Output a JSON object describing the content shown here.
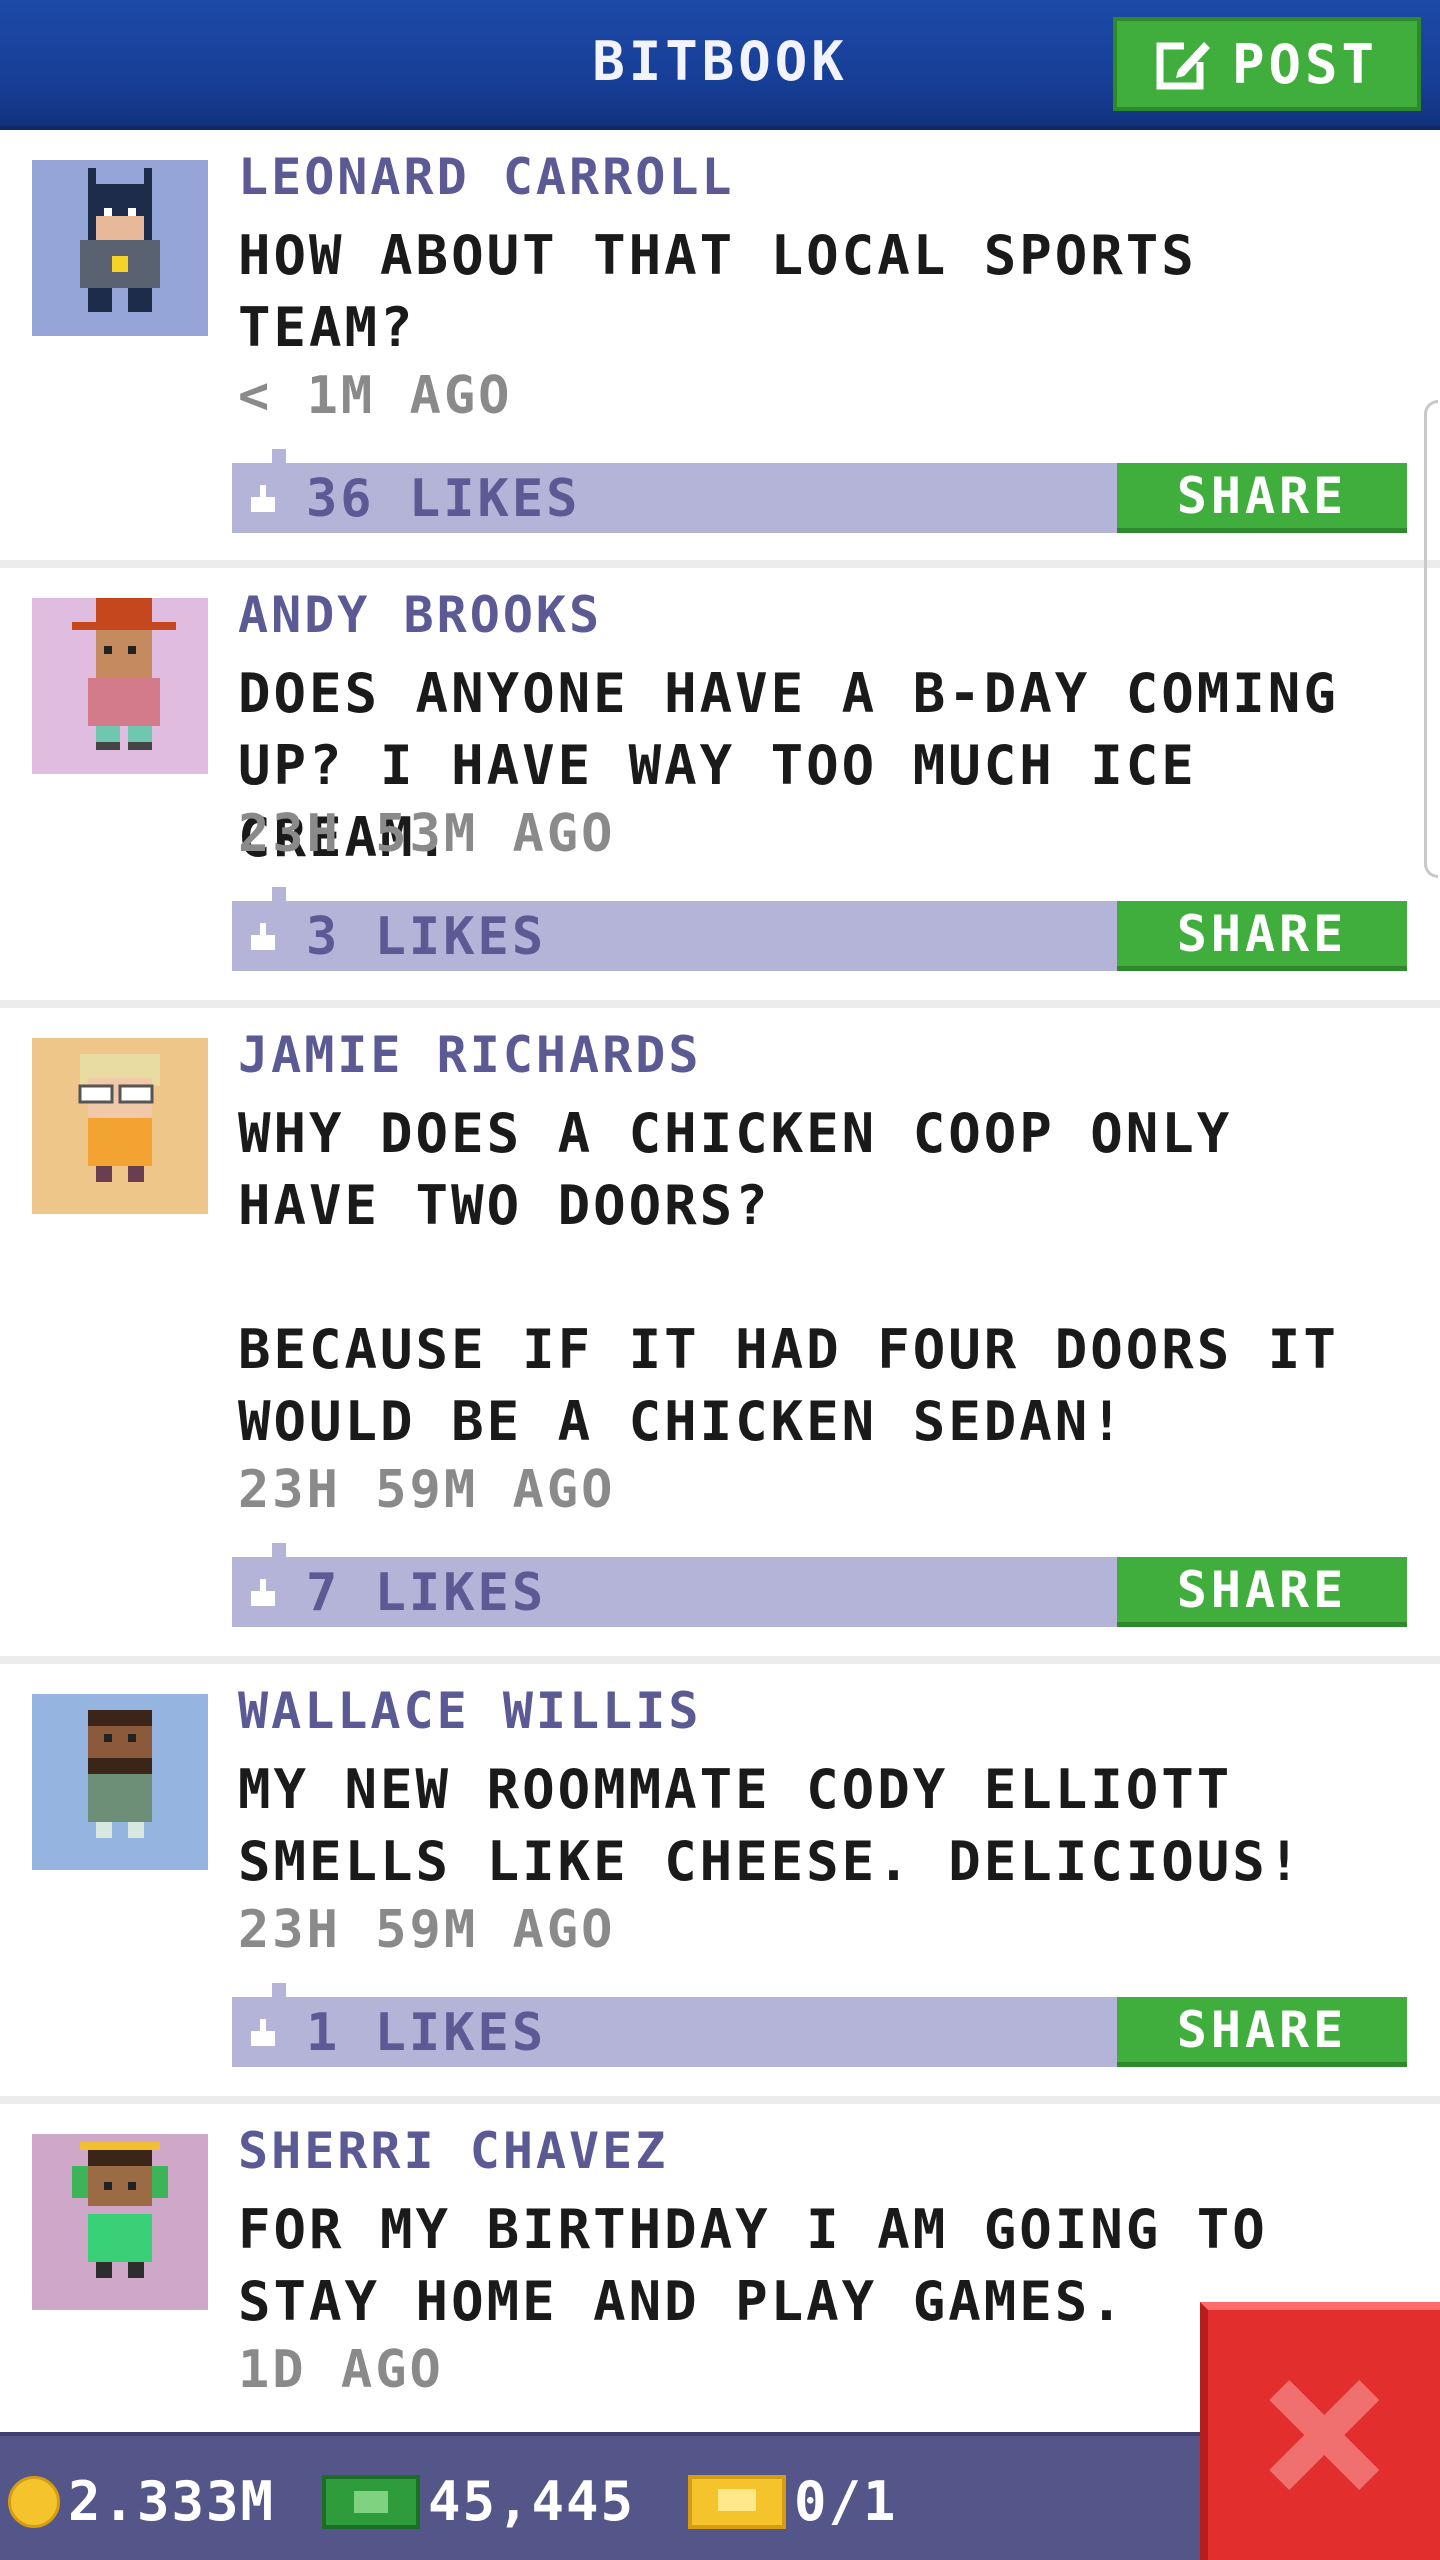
{
  "header": {
    "title": "BITBOOK",
    "post_label": "POST"
  },
  "posts": [
    {
      "author": "LEONARD CARROLL",
      "text": "HOW ABOUT THAT LOCAL SPORTS\nTEAM?",
      "time": "< 1M AGO",
      "likes": "36 LIKES",
      "share_label": "SHARE",
      "avatar": "batman-costume-avatar"
    },
    {
      "author": "ANDY BROOKS",
      "text": "DOES ANYONE HAVE A B-DAY COMING\nUP? I HAVE WAY TOO MUCH ICE CREAM.",
      "time": "23H 53M AGO",
      "likes": "3 LIKES",
      "share_label": "SHARE",
      "avatar": "orange-hat-avatar"
    },
    {
      "author": "JAMIE RICHARDS",
      "text": "WHY DOES A CHICKEN COOP ONLY\nHAVE TWO DOORS?\n\nBECAUSE IF IT HAD FOUR DOORS IT\nWOULD BE A CHICKEN SEDAN!",
      "time": "23H 59M AGO",
      "likes": "7 LIKES",
      "share_label": "SHARE",
      "avatar": "glasses-avatar"
    },
    {
      "author": "WALLACE WILLIS",
      "text": "MY NEW ROOMMATE CODY ELLIOTT\nSMELLS LIKE CHEESE. DELICIOUS!",
      "time": "23H 59M AGO",
      "likes": "1 LIKES",
      "share_label": "SHARE",
      "avatar": "bearded-avatar"
    },
    {
      "author": "SHERRI CHAVEZ",
      "text": "FOR MY BIRTHDAY I AM GOING TO\nSTAY HOME AND PLAY GAMES.",
      "time": "1D AGO",
      "likes": "",
      "share_label": "",
      "avatar": "headphones-avatar"
    }
  ],
  "bottom_bar": {
    "coins": "2.333M",
    "bux": "45,445",
    "tickets": "0/1"
  },
  "colors": {
    "header_blue": "#1d4aa8",
    "accent_green": "#3fae3c",
    "likes_bar": "#b3b4d7",
    "author_purple": "#5c5a94",
    "close_red": "#e32e2e"
  }
}
